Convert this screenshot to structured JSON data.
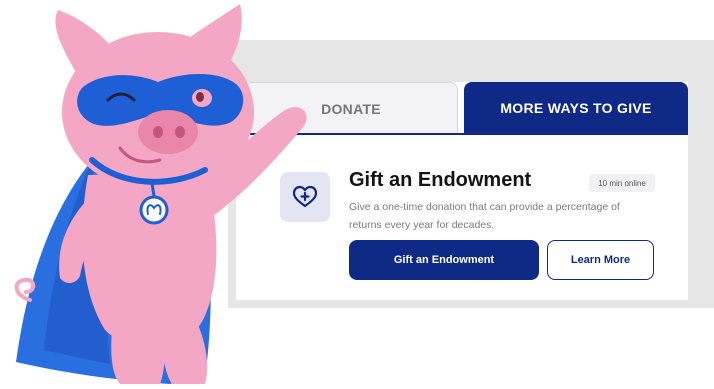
{
  "tabs": [
    {
      "label": "DONATE",
      "active": false
    },
    {
      "label": "MORE WAYS TO GIVE",
      "active": true
    }
  ],
  "offer": {
    "icon": "heart-plus-icon",
    "title": "Gift an Endowment",
    "duration_badge": "10 min online",
    "description": "Give a one-time donation that can provide a percentage of returns every year for decades.",
    "primary_button": "Gift an Endowment",
    "secondary_button": "Learn More"
  },
  "mascot": {
    "icon": "superhero-pig-mascot"
  },
  "colors": {
    "brand_navy": "#0f2a86",
    "pig_pink": "#f4a7c4",
    "mask_blue": "#1f5fd6",
    "cape_blue": "#2a6fe0"
  }
}
